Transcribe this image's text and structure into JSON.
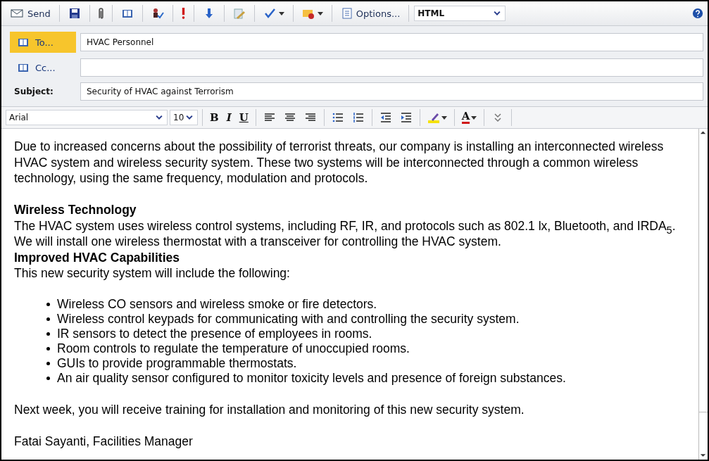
{
  "toolbar": {
    "items": [
      {
        "kind": "send",
        "label": "Send"
      },
      {
        "kind": "save"
      },
      {
        "kind": "attach"
      },
      {
        "kind": "address-book"
      },
      {
        "kind": "check-names"
      },
      {
        "kind": "importance-high"
      },
      {
        "kind": "importance-low"
      },
      {
        "kind": "signature"
      },
      {
        "kind": "spelling",
        "dropdown": true
      },
      {
        "kind": "flag",
        "dropdown": true
      },
      {
        "kind": "options",
        "label": "Options..."
      },
      {
        "kind": "format",
        "value": "HTML",
        "dropdown": true
      }
    ]
  },
  "header": {
    "to": {
      "label": "To...",
      "value": "HVAC Personnel",
      "selected": true
    },
    "cc": {
      "label": "Cc...",
      "selected": false
    },
    "subject": {
      "label": "Subject:",
      "value": "Security of HVAC against Terrorism"
    }
  },
  "format_bar": {
    "font": "Arial",
    "size": "10",
    "items": [
      {
        "kind": "bold",
        "label": "B"
      },
      {
        "kind": "italic",
        "label": "I"
      },
      {
        "kind": "underline",
        "label": "U"
      },
      {
        "kind": "align-left"
      },
      {
        "kind": "align-center"
      },
      {
        "kind": "align-right"
      },
      {
        "kind": "bullets"
      },
      {
        "kind": "numbering"
      },
      {
        "kind": "outdent"
      },
      {
        "kind": "indent"
      },
      {
        "kind": "highlight"
      },
      {
        "kind": "font-color",
        "label": "A"
      },
      {
        "kind": "more"
      }
    ]
  },
  "body": [
    {
      "kind": "paragraph",
      "text": "Due to increased concerns about the possibility of terrorist threats, our company is installing an interconnected wireless HVAC system and wireless security system.  These two systems will be interconnected through a common wireless technology, using the same frequency, modulation and protocols."
    },
    {
      "kind": "heading",
      "text": "Wireless Technology"
    },
    {
      "kind": "paragraph",
      "text": "The HVAC system uses wireless control systems, including RF, IR, and protocols such as 802.1 lx, Bluetooth, and IRDA$_{5}$.  We will install one wireless thermostat with a transceiver for controlling the HVAC system."
    },
    {
      "kind": "heading",
      "text": "Improved HVAC Capabilities"
    },
    {
      "kind": "paragraph",
      "text": "This new security system will include the following:"
    },
    {
      "kind": "list",
      "items": [
        "Wireless CO sensors and wireless smoke or fire detectors.",
        "Wireless control keypads for communicating with and controlling the security system.",
        "IR sensors to detect the presence of employees in rooms.",
        "Room controls to regulate the temperature of unoccupied rooms.",
        "GUIs to provide programmable thermostats.",
        "An air quality sensor configured to monitor toxicity levels and presence of foreign substances."
      ]
    },
    {
      "kind": "paragraph",
      "text": "Next week, you will receive training for installation and monitoring of this new security system."
    },
    {
      "kind": "paragraph",
      "text": "Fatai Sayanti, Facilities Manager"
    }
  ]
}
